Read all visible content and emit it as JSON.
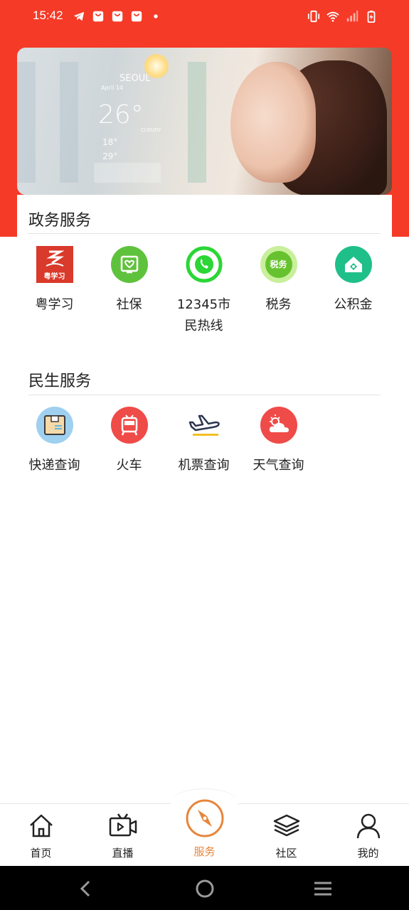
{
  "status_bar": {
    "time": "15:42",
    "left_icons": [
      "telegram-icon",
      "bag-icon",
      "bag-icon",
      "bag-icon",
      "dot-icon"
    ],
    "right_icons": [
      "vibrate-icon",
      "wifi-icon",
      "signal-icon",
      "battery-charging-icon"
    ]
  },
  "banner": {
    "city": "SEOUL",
    "date": "April 14",
    "temp": "26°",
    "condition": "CLOUDY",
    "low": "18°",
    "high": "29°"
  },
  "gov_section": {
    "title": "政务服务",
    "items": [
      {
        "label": "粤学习",
        "icon": "yue-study-icon",
        "icon_text": "粤学习",
        "color": "#d93a2b"
      },
      {
        "label": "社保",
        "icon": "social-security-icon",
        "color": "#5fc23c"
      },
      {
        "label": "12345市民热线",
        "icon": "phone-icon",
        "color": "#2bd635"
      },
      {
        "label": "税务",
        "icon": "tax-icon",
        "icon_text": "税务",
        "color": "#66c22e"
      },
      {
        "label": "公积金",
        "icon": "housing-fund-icon",
        "color": "#1fbf8a"
      }
    ]
  },
  "life_section": {
    "title": "民生服务",
    "items": [
      {
        "label": "快递查询",
        "icon": "express-box-icon",
        "color": "#9fd0f0"
      },
      {
        "label": "火车",
        "icon": "train-icon",
        "color": "#ef4b48"
      },
      {
        "label": "机票查询",
        "icon": "airplane-icon",
        "color": "#2c3550"
      },
      {
        "label": "天气查询",
        "icon": "weather-icon",
        "color": "#ef4b48"
      }
    ]
  },
  "bottom_nav": {
    "items": [
      {
        "label": "首页",
        "icon": "home-icon"
      },
      {
        "label": "直播",
        "icon": "live-tv-icon"
      },
      {
        "label": "服务",
        "icon": "compass-icon",
        "active": true
      },
      {
        "label": "社区",
        "icon": "layers-icon"
      },
      {
        "label": "我的",
        "icon": "user-icon"
      }
    ],
    "accent": "#e8853a"
  },
  "system_nav": [
    "back-icon",
    "home-circle-icon",
    "menu-icon"
  ],
  "colors": {
    "brand_red": "#f53a27"
  }
}
